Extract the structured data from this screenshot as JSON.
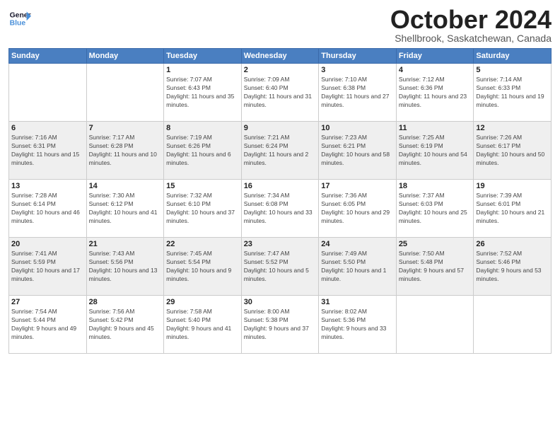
{
  "header": {
    "logo_line1": "General",
    "logo_line2": "Blue",
    "month": "October 2024",
    "location": "Shellbrook, Saskatchewan, Canada"
  },
  "days_of_week": [
    "Sunday",
    "Monday",
    "Tuesday",
    "Wednesday",
    "Thursday",
    "Friday",
    "Saturday"
  ],
  "weeks": [
    [
      {
        "day": "",
        "info": ""
      },
      {
        "day": "",
        "info": ""
      },
      {
        "day": "1",
        "info": "Sunrise: 7:07 AM\nSunset: 6:43 PM\nDaylight: 11 hours and 35 minutes."
      },
      {
        "day": "2",
        "info": "Sunrise: 7:09 AM\nSunset: 6:40 PM\nDaylight: 11 hours and 31 minutes."
      },
      {
        "day": "3",
        "info": "Sunrise: 7:10 AM\nSunset: 6:38 PM\nDaylight: 11 hours and 27 minutes."
      },
      {
        "day": "4",
        "info": "Sunrise: 7:12 AM\nSunset: 6:36 PM\nDaylight: 11 hours and 23 minutes."
      },
      {
        "day": "5",
        "info": "Sunrise: 7:14 AM\nSunset: 6:33 PM\nDaylight: 11 hours and 19 minutes."
      }
    ],
    [
      {
        "day": "6",
        "info": "Sunrise: 7:16 AM\nSunset: 6:31 PM\nDaylight: 11 hours and 15 minutes."
      },
      {
        "day": "7",
        "info": "Sunrise: 7:17 AM\nSunset: 6:28 PM\nDaylight: 11 hours and 10 minutes."
      },
      {
        "day": "8",
        "info": "Sunrise: 7:19 AM\nSunset: 6:26 PM\nDaylight: 11 hours and 6 minutes."
      },
      {
        "day": "9",
        "info": "Sunrise: 7:21 AM\nSunset: 6:24 PM\nDaylight: 11 hours and 2 minutes."
      },
      {
        "day": "10",
        "info": "Sunrise: 7:23 AM\nSunset: 6:21 PM\nDaylight: 10 hours and 58 minutes."
      },
      {
        "day": "11",
        "info": "Sunrise: 7:25 AM\nSunset: 6:19 PM\nDaylight: 10 hours and 54 minutes."
      },
      {
        "day": "12",
        "info": "Sunrise: 7:26 AM\nSunset: 6:17 PM\nDaylight: 10 hours and 50 minutes."
      }
    ],
    [
      {
        "day": "13",
        "info": "Sunrise: 7:28 AM\nSunset: 6:14 PM\nDaylight: 10 hours and 46 minutes."
      },
      {
        "day": "14",
        "info": "Sunrise: 7:30 AM\nSunset: 6:12 PM\nDaylight: 10 hours and 41 minutes."
      },
      {
        "day": "15",
        "info": "Sunrise: 7:32 AM\nSunset: 6:10 PM\nDaylight: 10 hours and 37 minutes."
      },
      {
        "day": "16",
        "info": "Sunrise: 7:34 AM\nSunset: 6:08 PM\nDaylight: 10 hours and 33 minutes."
      },
      {
        "day": "17",
        "info": "Sunrise: 7:36 AM\nSunset: 6:05 PM\nDaylight: 10 hours and 29 minutes."
      },
      {
        "day": "18",
        "info": "Sunrise: 7:37 AM\nSunset: 6:03 PM\nDaylight: 10 hours and 25 minutes."
      },
      {
        "day": "19",
        "info": "Sunrise: 7:39 AM\nSunset: 6:01 PM\nDaylight: 10 hours and 21 minutes."
      }
    ],
    [
      {
        "day": "20",
        "info": "Sunrise: 7:41 AM\nSunset: 5:59 PM\nDaylight: 10 hours and 17 minutes."
      },
      {
        "day": "21",
        "info": "Sunrise: 7:43 AM\nSunset: 5:56 PM\nDaylight: 10 hours and 13 minutes."
      },
      {
        "day": "22",
        "info": "Sunrise: 7:45 AM\nSunset: 5:54 PM\nDaylight: 10 hours and 9 minutes."
      },
      {
        "day": "23",
        "info": "Sunrise: 7:47 AM\nSunset: 5:52 PM\nDaylight: 10 hours and 5 minutes."
      },
      {
        "day": "24",
        "info": "Sunrise: 7:49 AM\nSunset: 5:50 PM\nDaylight: 10 hours and 1 minute."
      },
      {
        "day": "25",
        "info": "Sunrise: 7:50 AM\nSunset: 5:48 PM\nDaylight: 9 hours and 57 minutes."
      },
      {
        "day": "26",
        "info": "Sunrise: 7:52 AM\nSunset: 5:46 PM\nDaylight: 9 hours and 53 minutes."
      }
    ],
    [
      {
        "day": "27",
        "info": "Sunrise: 7:54 AM\nSunset: 5:44 PM\nDaylight: 9 hours and 49 minutes."
      },
      {
        "day": "28",
        "info": "Sunrise: 7:56 AM\nSunset: 5:42 PM\nDaylight: 9 hours and 45 minutes."
      },
      {
        "day": "29",
        "info": "Sunrise: 7:58 AM\nSunset: 5:40 PM\nDaylight: 9 hours and 41 minutes."
      },
      {
        "day": "30",
        "info": "Sunrise: 8:00 AM\nSunset: 5:38 PM\nDaylight: 9 hours and 37 minutes."
      },
      {
        "day": "31",
        "info": "Sunrise: 8:02 AM\nSunset: 5:36 PM\nDaylight: 9 hours and 33 minutes."
      },
      {
        "day": "",
        "info": ""
      },
      {
        "day": "",
        "info": ""
      }
    ]
  ]
}
